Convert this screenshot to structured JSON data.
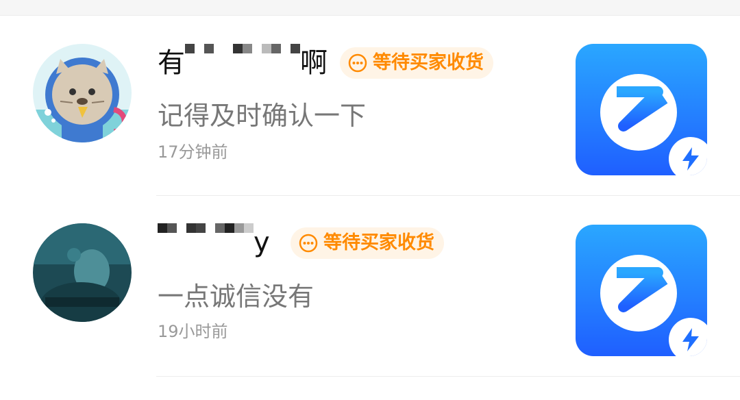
{
  "colors": {
    "badge_text": "#ff8a00",
    "badge_bg": "#fff4e6",
    "thumb_blue": "#1f6fff",
    "message_text": "#777777",
    "time_text": "#999999"
  },
  "conversations": [
    {
      "name_visible_start": "有",
      "name_visible_end": "啊",
      "name_obscured": true,
      "status_badge": "等待买家收货",
      "badge_icon": "dots-circle-icon",
      "message": "记得及时确认一下",
      "time": "17分钟前",
      "avatar_icon": "seal-astronaut-avatar",
      "thumbnail_icon": "app-logo-icon"
    },
    {
      "name_visible_start": "",
      "name_visible_end": "y",
      "name_obscured": true,
      "status_badge": "等待买家收货",
      "badge_icon": "dots-circle-icon",
      "message": "一点诚信没有",
      "time": "19小时前",
      "avatar_icon": "dark-portrait-avatar",
      "thumbnail_icon": "app-logo-icon"
    }
  ]
}
